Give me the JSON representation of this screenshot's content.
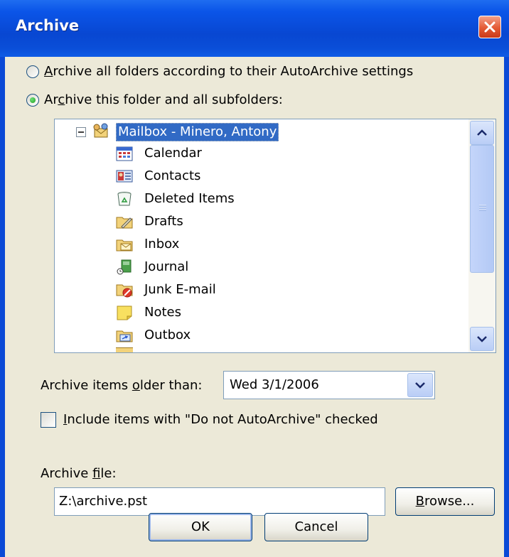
{
  "window": {
    "title": "Archive",
    "close_icon": "close-icon"
  },
  "options": {
    "archive_all": {
      "pre": "",
      "access_key": "A",
      "post": "rchive all folders according to their AutoArchive settings",
      "selected": false
    },
    "archive_this": {
      "pre": "Ar",
      "access_key": "c",
      "post": "hive this folder and all subfolders:",
      "selected": true
    }
  },
  "folder_tree": {
    "root": {
      "label": "Mailbox - Minero, Antony",
      "expander": "⊟",
      "icon": "mailbox-icon",
      "selected": true
    },
    "items": [
      {
        "label": "Calendar",
        "icon": "calendar-icon"
      },
      {
        "label": "Contacts",
        "icon": "contacts-icon"
      },
      {
        "label": "Deleted Items",
        "icon": "deleted-items-icon"
      },
      {
        "label": "Drafts",
        "icon": "drafts-icon"
      },
      {
        "label": "Inbox",
        "icon": "inbox-icon"
      },
      {
        "label": "Journal",
        "icon": "journal-icon"
      },
      {
        "label": "Junk E-mail",
        "icon": "junk-email-icon"
      },
      {
        "label": "Notes",
        "icon": "notes-icon"
      },
      {
        "label": "Outbox",
        "icon": "outbox-icon"
      }
    ]
  },
  "older_than": {
    "pre": "Archive items ",
    "access_key": "o",
    "post": "lder than:",
    "value": "Wed 3/1/2006"
  },
  "include_checkbox": {
    "pre": "",
    "access_key": "I",
    "post": "nclude items with \"Do not AutoArchive\" checked",
    "checked": false
  },
  "archive_file": {
    "pre": "Archive ",
    "access_key": "f",
    "post": "ile:",
    "value": "Z:\\archive.pst"
  },
  "buttons": {
    "browse": {
      "pre": "",
      "access_key": "B",
      "post": "rowse..."
    },
    "ok": "OK",
    "cancel": "Cancel"
  },
  "colors": {
    "title_bar": "#0a49d6",
    "dialog_bg": "#ece9d8",
    "selection": "#316ac5",
    "close": "#e45a34"
  }
}
